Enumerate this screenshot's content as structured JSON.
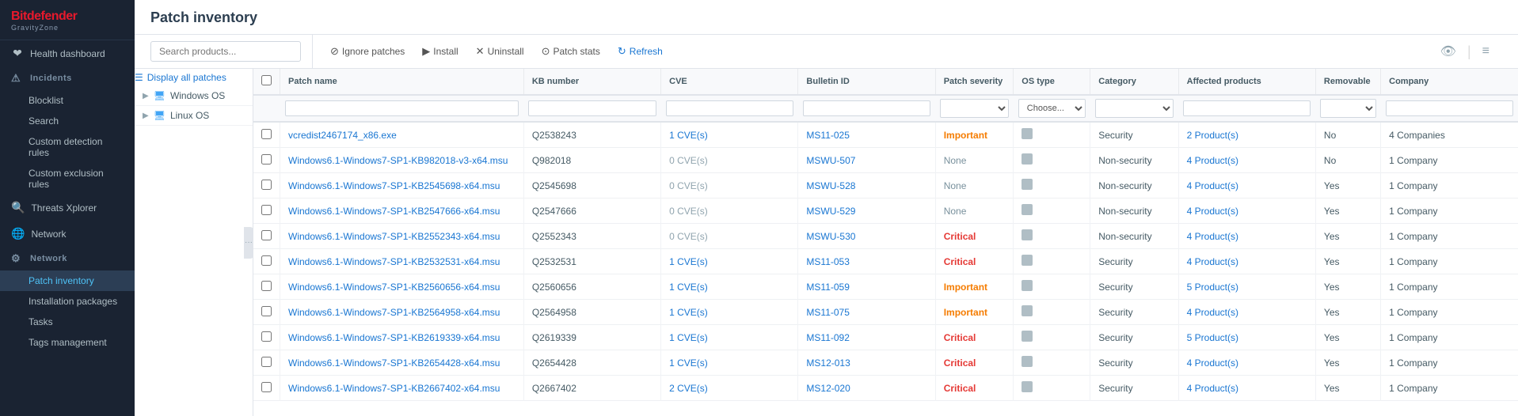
{
  "app": {
    "brand": "Bitdefender",
    "sub": "GravityZone"
  },
  "topbar": {
    "icons": [
      "👤",
      "🔔",
      "⚡"
    ]
  },
  "sidebar": {
    "items": [
      {
        "label": "Health dashboard",
        "icon": "❤",
        "type": "item"
      },
      {
        "label": "Incidents",
        "icon": "⚠",
        "type": "section"
      },
      {
        "label": "Blocklist",
        "icon": "",
        "type": "sub"
      },
      {
        "label": "Search",
        "icon": "",
        "type": "sub"
      },
      {
        "label": "Custom detection rules",
        "icon": "",
        "type": "sub"
      },
      {
        "label": "Custom exclusion rules",
        "icon": "",
        "type": "sub"
      },
      {
        "label": "Threats Xplorer",
        "icon": "🔍",
        "type": "item"
      },
      {
        "label": "Network",
        "icon": "🌐",
        "type": "item"
      },
      {
        "label": "Network",
        "icon": "⚙",
        "type": "section-active"
      },
      {
        "label": "Patch inventory",
        "icon": "",
        "type": "sub-active"
      },
      {
        "label": "Installation packages",
        "icon": "",
        "type": "sub"
      },
      {
        "label": "Tasks",
        "icon": "",
        "type": "sub"
      },
      {
        "label": "Tags management",
        "icon": "",
        "type": "sub"
      }
    ]
  },
  "page": {
    "title": "Patch inventory"
  },
  "toolbar": {
    "search_placeholder": "Search products...",
    "display_all": "Display all patches",
    "buttons": [
      {
        "label": "Ignore patches",
        "icon": "⊘",
        "key": "ignore-patches"
      },
      {
        "label": "Install",
        "icon": "▶",
        "key": "install"
      },
      {
        "label": "Uninstall",
        "icon": "✕",
        "key": "uninstall"
      },
      {
        "label": "Patch stats",
        "icon": "⊙",
        "key": "patch-stats"
      },
      {
        "label": "Refresh",
        "icon": "↻",
        "key": "refresh",
        "active": true
      }
    ]
  },
  "tree": {
    "items": [
      {
        "label": "Windows OS",
        "type": "group"
      },
      {
        "label": "Linux OS",
        "type": "group"
      }
    ]
  },
  "table": {
    "columns": [
      {
        "key": "patch_name",
        "label": "Patch name"
      },
      {
        "key": "kb_number",
        "label": "KB number"
      },
      {
        "key": "cve",
        "label": "CVE"
      },
      {
        "key": "bulletin_id",
        "label": "Bulletin ID"
      },
      {
        "key": "patch_severity",
        "label": "Patch severity"
      },
      {
        "key": "os_type",
        "label": "OS type"
      },
      {
        "key": "category",
        "label": "Category"
      },
      {
        "key": "affected_products",
        "label": "Affected products"
      },
      {
        "key": "removable",
        "label": "Removable"
      },
      {
        "key": "company",
        "label": "Company"
      }
    ],
    "rows": [
      {
        "patch_name": "vcredist2467174_x86.exe",
        "kb": "Q2538243",
        "cve": "1 CVE(s)",
        "cve_type": "blue",
        "bulletin": "MS11-025",
        "severity": "Important",
        "sev_class": "important",
        "category": "Security",
        "products": "2 Product(s)",
        "removable": "No",
        "company": "4 Companies"
      },
      {
        "patch_name": "Windows6.1-Windows7-SP1-KB982018-v3-x64.msu",
        "kb": "Q982018",
        "cve": "0 CVE(s)",
        "cve_type": "gray",
        "bulletin": "MSWU-507",
        "severity": "None",
        "sev_class": "none",
        "category": "Non-security",
        "products": "4 Product(s)",
        "removable": "No",
        "company": "1 Company"
      },
      {
        "patch_name": "Windows6.1-Windows7-SP1-KB2545698-x64.msu",
        "kb": "Q2545698",
        "cve": "0 CVE(s)",
        "cve_type": "gray",
        "bulletin": "MSWU-528",
        "severity": "None",
        "sev_class": "none",
        "category": "Non-security",
        "products": "4 Product(s)",
        "removable": "Yes",
        "company": "1 Company"
      },
      {
        "patch_name": "Windows6.1-Windows7-SP1-KB2547666-x64.msu",
        "kb": "Q2547666",
        "cve": "0 CVE(s)",
        "cve_type": "gray",
        "bulletin": "MSWU-529",
        "severity": "None",
        "sev_class": "none",
        "category": "Non-security",
        "products": "4 Product(s)",
        "removable": "Yes",
        "company": "1 Company"
      },
      {
        "patch_name": "Windows6.1-Windows7-SP1-KB2552343-x64.msu",
        "kb": "Q2552343",
        "cve": "0 CVE(s)",
        "cve_type": "gray",
        "bulletin": "MSWU-530",
        "severity": "Critical",
        "sev_class": "critical",
        "category": "Non-security",
        "products": "4 Product(s)",
        "removable": "Yes",
        "company": "1 Company"
      },
      {
        "patch_name": "Windows6.1-Windows7-SP1-KB2532531-x64.msu",
        "kb": "Q2532531",
        "cve": "1 CVE(s)",
        "cve_type": "blue",
        "bulletin": "MS11-053",
        "severity": "Critical",
        "sev_class": "critical",
        "category": "Security",
        "products": "4 Product(s)",
        "removable": "Yes",
        "company": "1 Company"
      },
      {
        "patch_name": "Windows6.1-Windows7-SP1-KB2560656-x64.msu",
        "kb": "Q2560656",
        "cve": "1 CVE(s)",
        "cve_type": "blue",
        "bulletin": "MS11-059",
        "severity": "Important",
        "sev_class": "important",
        "category": "Security",
        "products": "5 Product(s)",
        "removable": "Yes",
        "company": "1 Company"
      },
      {
        "patch_name": "Windows6.1-Windows7-SP1-KB2564958-x64.msu",
        "kb": "Q2564958",
        "cve": "1 CVE(s)",
        "cve_type": "blue",
        "bulletin": "MS11-075",
        "severity": "Important",
        "sev_class": "important",
        "category": "Security",
        "products": "4 Product(s)",
        "removable": "Yes",
        "company": "1 Company"
      },
      {
        "patch_name": "Windows6.1-Windows7-SP1-KB2619339-x64.msu",
        "kb": "Q2619339",
        "cve": "1 CVE(s)",
        "cve_type": "blue",
        "bulletin": "MS11-092",
        "severity": "Critical",
        "sev_class": "critical",
        "category": "Security",
        "products": "5 Product(s)",
        "removable": "Yes",
        "company": "1 Company"
      },
      {
        "patch_name": "Windows6.1-Windows7-SP1-KB2654428-x64.msu",
        "kb": "Q2654428",
        "cve": "1 CVE(s)",
        "cve_type": "blue",
        "bulletin": "MS12-013",
        "severity": "Critical",
        "sev_class": "critical",
        "category": "Security",
        "products": "4 Product(s)",
        "removable": "Yes",
        "company": "1 Company"
      },
      {
        "patch_name": "Windows6.1-Windows7-SP1-KB2667402-x64.msu",
        "kb": "Q2667402",
        "cve": "2 CVE(s)",
        "cve_type": "blue",
        "bulletin": "MS12-020",
        "severity": "Critical",
        "sev_class": "critical",
        "category": "Security",
        "products": "4 Product(s)",
        "removable": "Yes",
        "company": "1 Company"
      }
    ]
  }
}
